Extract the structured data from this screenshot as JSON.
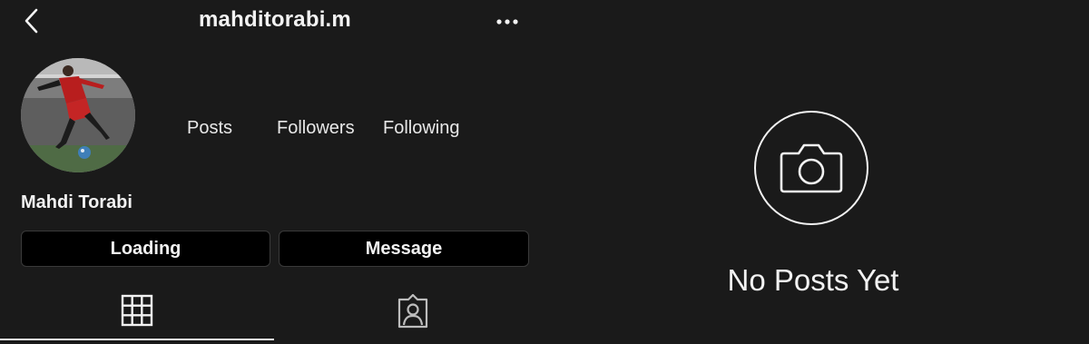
{
  "header": {
    "username": "mahditorabi.m",
    "back_icon": "chevron-left-icon",
    "more_icon": "ellipsis-icon"
  },
  "profile": {
    "display_name": "Mahdi Torabi",
    "avatar": "soccer-player-photo",
    "stats": {
      "posts_label": "Posts",
      "followers_label": "Followers",
      "following_label": "Following"
    }
  },
  "actions": {
    "primary_label": "Loading",
    "message_label": "Message"
  },
  "tabs": [
    {
      "icon": "grid-icon",
      "active": true
    },
    {
      "icon": "tagged-person-icon",
      "active": false
    }
  ],
  "empty_state": {
    "icon": "camera-icon",
    "text": "No Posts Yet"
  },
  "colors": {
    "background": "#1a1a1a",
    "button_background": "#000000",
    "text": "#f2f2f2"
  }
}
